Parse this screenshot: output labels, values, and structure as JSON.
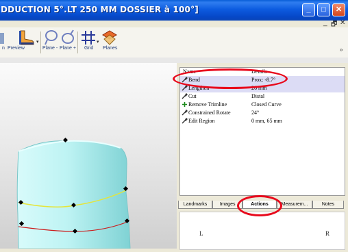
{
  "window": {
    "title": "DDUCTION 5°.LT 250 MM DOSSIER à 100°]",
    "controls": {
      "minimize": "_",
      "maximize": "□",
      "close": "✕"
    }
  },
  "mdi": {
    "minimize": "_",
    "restore": "🗗",
    "close": "✕"
  },
  "toolbar": {
    "items": [
      {
        "label": "n"
      },
      {
        "label": "Preview"
      },
      {
        "label": "Plane -"
      },
      {
        "label": "Plane +"
      },
      {
        "label": "Grid"
      },
      {
        "label": "Planes"
      }
    ],
    "overflow": "»"
  },
  "actions_list": {
    "headers": {
      "name": "Name",
      "details": "Details"
    },
    "rows": [
      {
        "icon": "wrench-icon",
        "name": "Bend",
        "details": "Prox: -8.7°",
        "selected": true
      },
      {
        "icon": "wrench-icon",
        "name": "Lengthen",
        "details": "26 mm",
        "selected": true
      },
      {
        "icon": "wrench-icon",
        "name": "Cut",
        "details": "Distal",
        "selected": false
      },
      {
        "icon": "plus-icon",
        "name": "Remove Trimline",
        "details": "Closed Curve",
        "selected": false
      },
      {
        "icon": "wrench-icon",
        "name": "Constrained Rotate",
        "details": "24°",
        "selected": false
      },
      {
        "icon": "wrench-icon",
        "name": "Edit Region",
        "details": "0 mm, 65 mm",
        "selected": false
      }
    ]
  },
  "tabs": [
    {
      "label": "Landmarks",
      "active": false
    },
    {
      "label": "Images",
      "active": false
    },
    {
      "label": "Actions",
      "active": true
    },
    {
      "label": "Measurem...",
      "active": false
    },
    {
      "label": "Notes",
      "active": false
    }
  ],
  "lower_panel": {
    "left_label": "L",
    "right_label": "R"
  },
  "colors": {
    "selection": "#dcdcf5",
    "annotation": "#e8091c",
    "model_surface": "#b8f1f0",
    "trimline": "#e5e53a",
    "cut_line": "#cc1a1a"
  }
}
